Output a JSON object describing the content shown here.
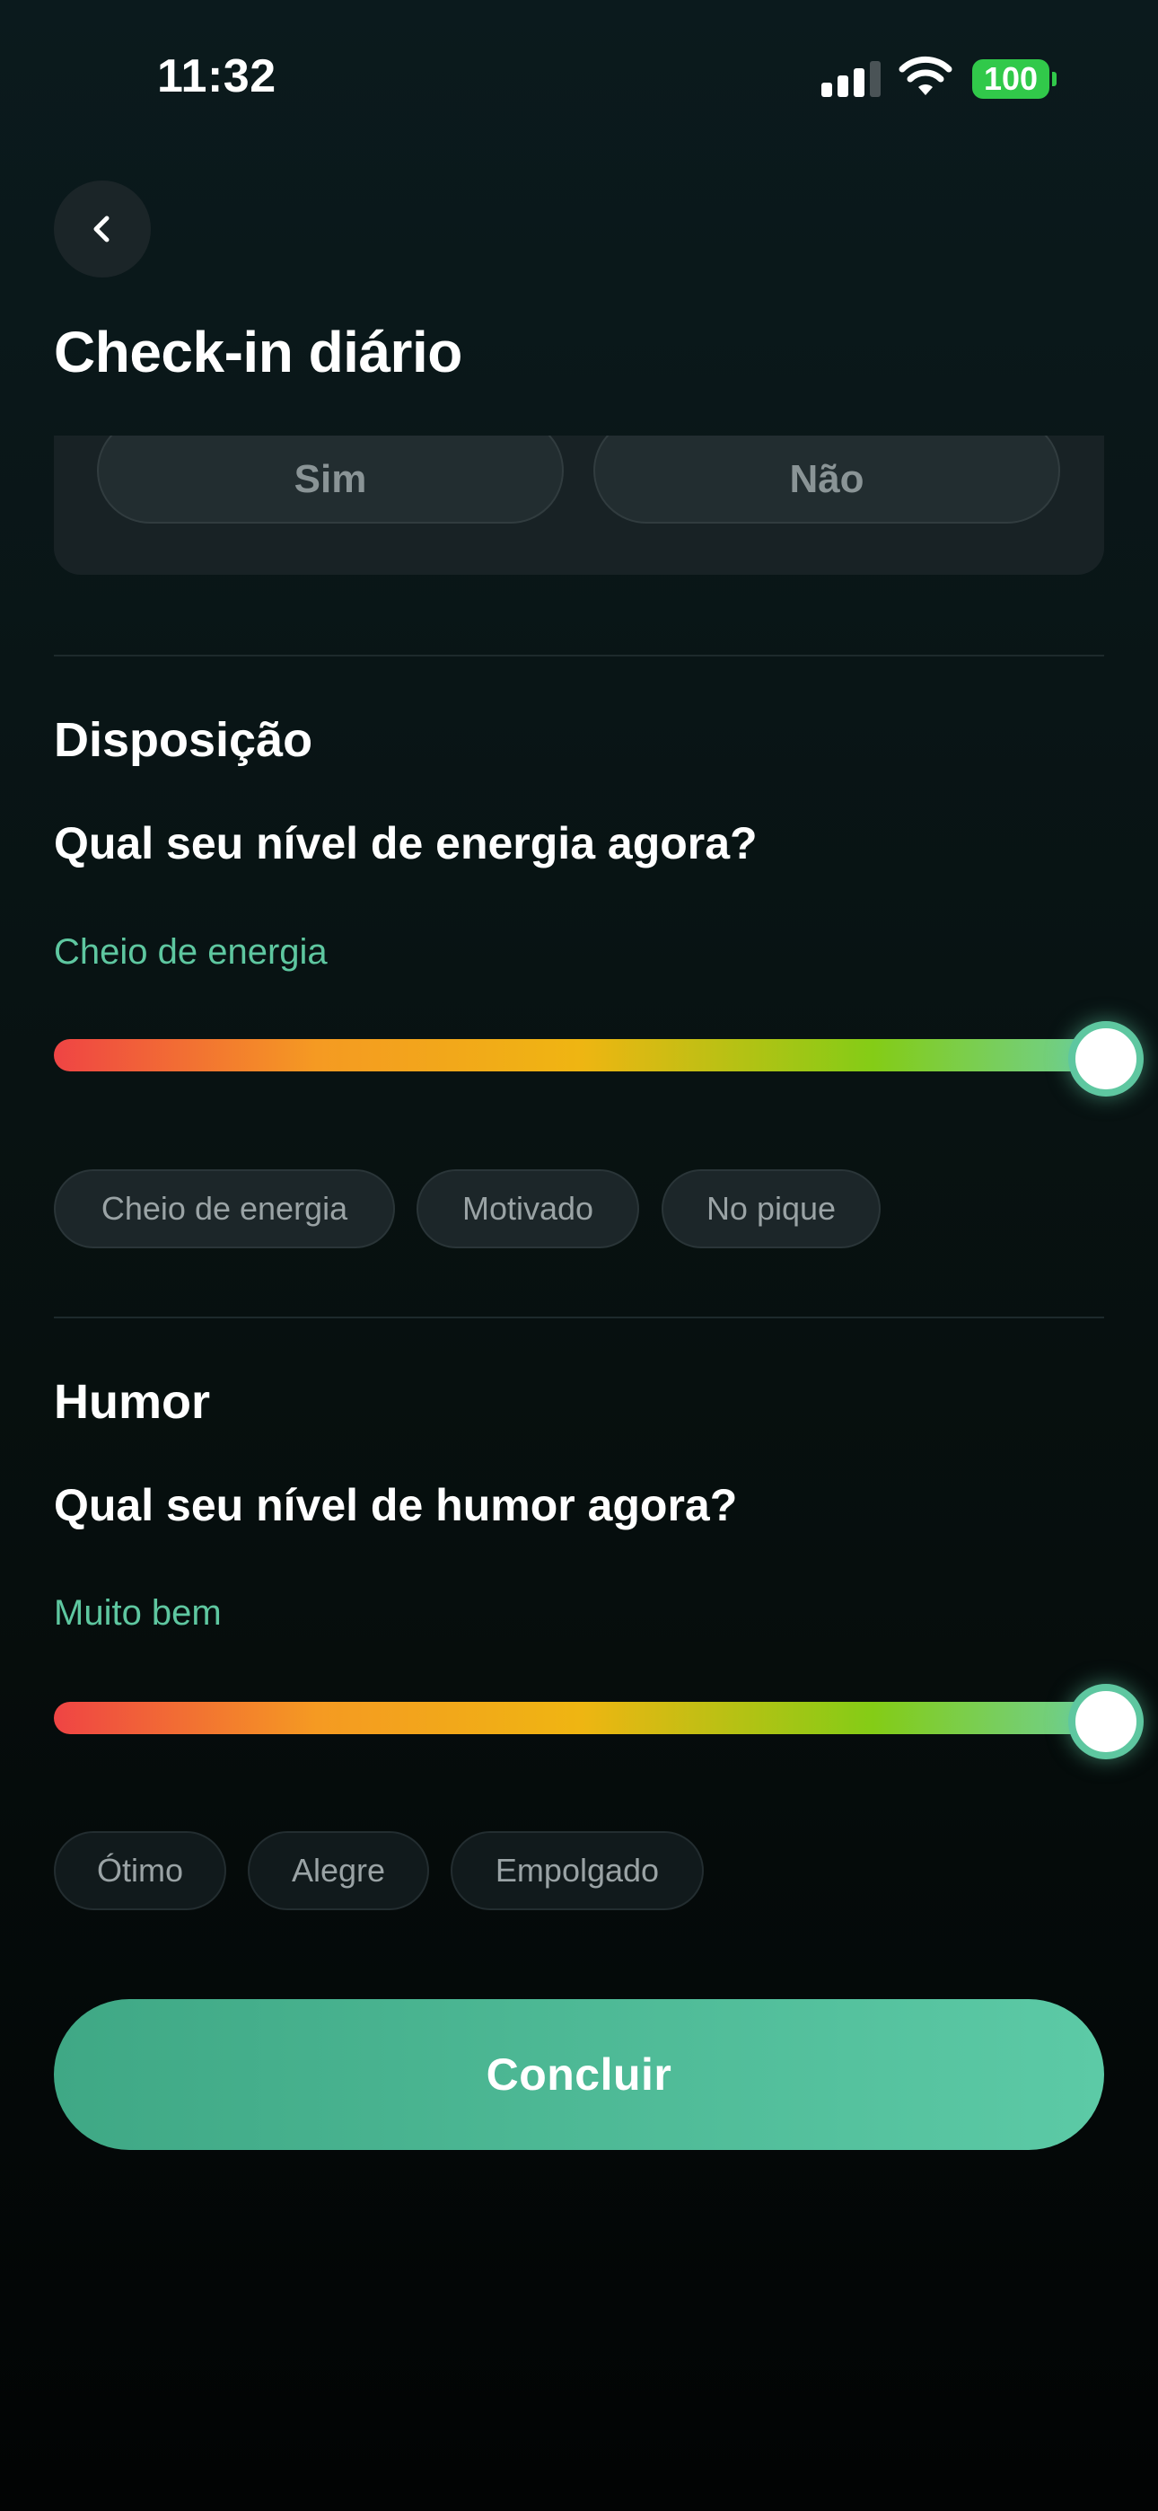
{
  "status_bar": {
    "time": "11:32",
    "battery": "100",
    "icons": [
      "signal-icon",
      "wifi-icon",
      "battery-icon"
    ]
  },
  "header": {
    "back_icon": "chevron-left-icon",
    "title": "Check-in diário"
  },
  "previous_question": {
    "options": [
      "Sim",
      "Não"
    ]
  },
  "sections": [
    {
      "title": "Disposição",
      "question": "Qual seu nível de energia agora?",
      "level_label": "Cheio de energia",
      "level_fraction": 1.0,
      "tags": [
        "Cheio de energia",
        "Motivado",
        "No pique"
      ]
    },
    {
      "title": "Humor",
      "question": "Qual seu nível de humor agora?",
      "level_label": "Muito bem",
      "level_fraction": 1.0,
      "tags": [
        "Ótimo",
        "Alegre",
        "Empolgado"
      ]
    }
  ],
  "actions": {
    "complete_label": "Concluir"
  },
  "colors": {
    "accent": "#5ec7a0",
    "battery": "#31c94a",
    "slider_gradient": [
      "#ef4444",
      "#f59a22",
      "#efb512",
      "#84cc16",
      "#6ed09a"
    ]
  }
}
